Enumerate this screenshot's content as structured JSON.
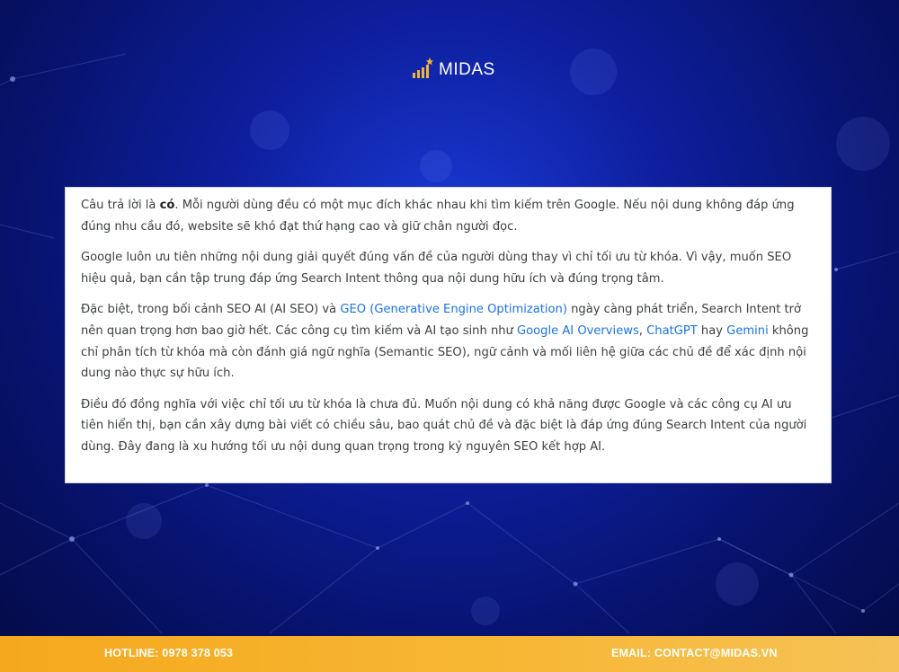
{
  "brand": {
    "name": "MIDAS",
    "gold": "#f2b431",
    "background": "#0e1f9e"
  },
  "article": {
    "p1": {
      "t1": "Câu trả lời là ",
      "b1": "có",
      "t2": ". Mỗi người dùng đều có một mục đích khác nhau khi tìm kiếm trên Google. Nếu nội dung không đáp ứng đúng nhu cầu đó, website sẽ khó đạt thứ hạng cao và giữ chân người đọc."
    },
    "p2": {
      "t1": "Google luôn ưu tiên những nội dung giải quyết đúng vấn đề của người dùng thay vì chỉ tối ưu từ khóa. Vì vậy, muốn SEO hiệu quả, bạn cần tập trung đáp ứng Search Intent thông qua nội dung hữu ích và đúng trọng tâm."
    },
    "p3": {
      "t1": "Đặc biệt, trong bối cảnh SEO AI (AI SEO) và ",
      "l1": "GEO (Generative Engine Optimization)",
      "t2": " ngày càng phát triển, Search Intent trở nên quan trọng hơn bao giờ hết. Các công cụ tìm kiếm và AI tạo sinh như ",
      "l2": "Google AI Overviews",
      "t3": ", ",
      "l3": "ChatGPT",
      "t4": " hay ",
      "l4": "Gemini",
      "t5": " không chỉ phân tích từ khóa mà còn đánh giá ngữ nghĩa (Semantic SEO), ngữ cảnh và mối liên hệ giữa các chủ đề để xác định nội dung nào thực sự hữu ích."
    },
    "p4": {
      "t1": "Điều đó đồng nghĩa với việc chỉ tối ưu từ khóa là chưa đủ. Muốn nội dung có khả năng được Google và các công cụ AI ưu tiên hiển thị, bạn cần xây dựng bài viết có chiều sâu, bao quát chủ đề và đặc biệt là đáp ứng đúng Search Intent của người dùng. Đây đang là xu hướng tối ưu nội dung quan trọng trong kỷ nguyên SEO kết hợp AI."
    },
    "link_color": "#1a73e8"
  },
  "footer": {
    "hotline": "HOTLINE: 0978 378 053",
    "email": "EMAIL: CONTACT@MIDAS.VN",
    "color": "#f7b733"
  },
  "icons": {
    "logo": "midas-logo-icon"
  }
}
